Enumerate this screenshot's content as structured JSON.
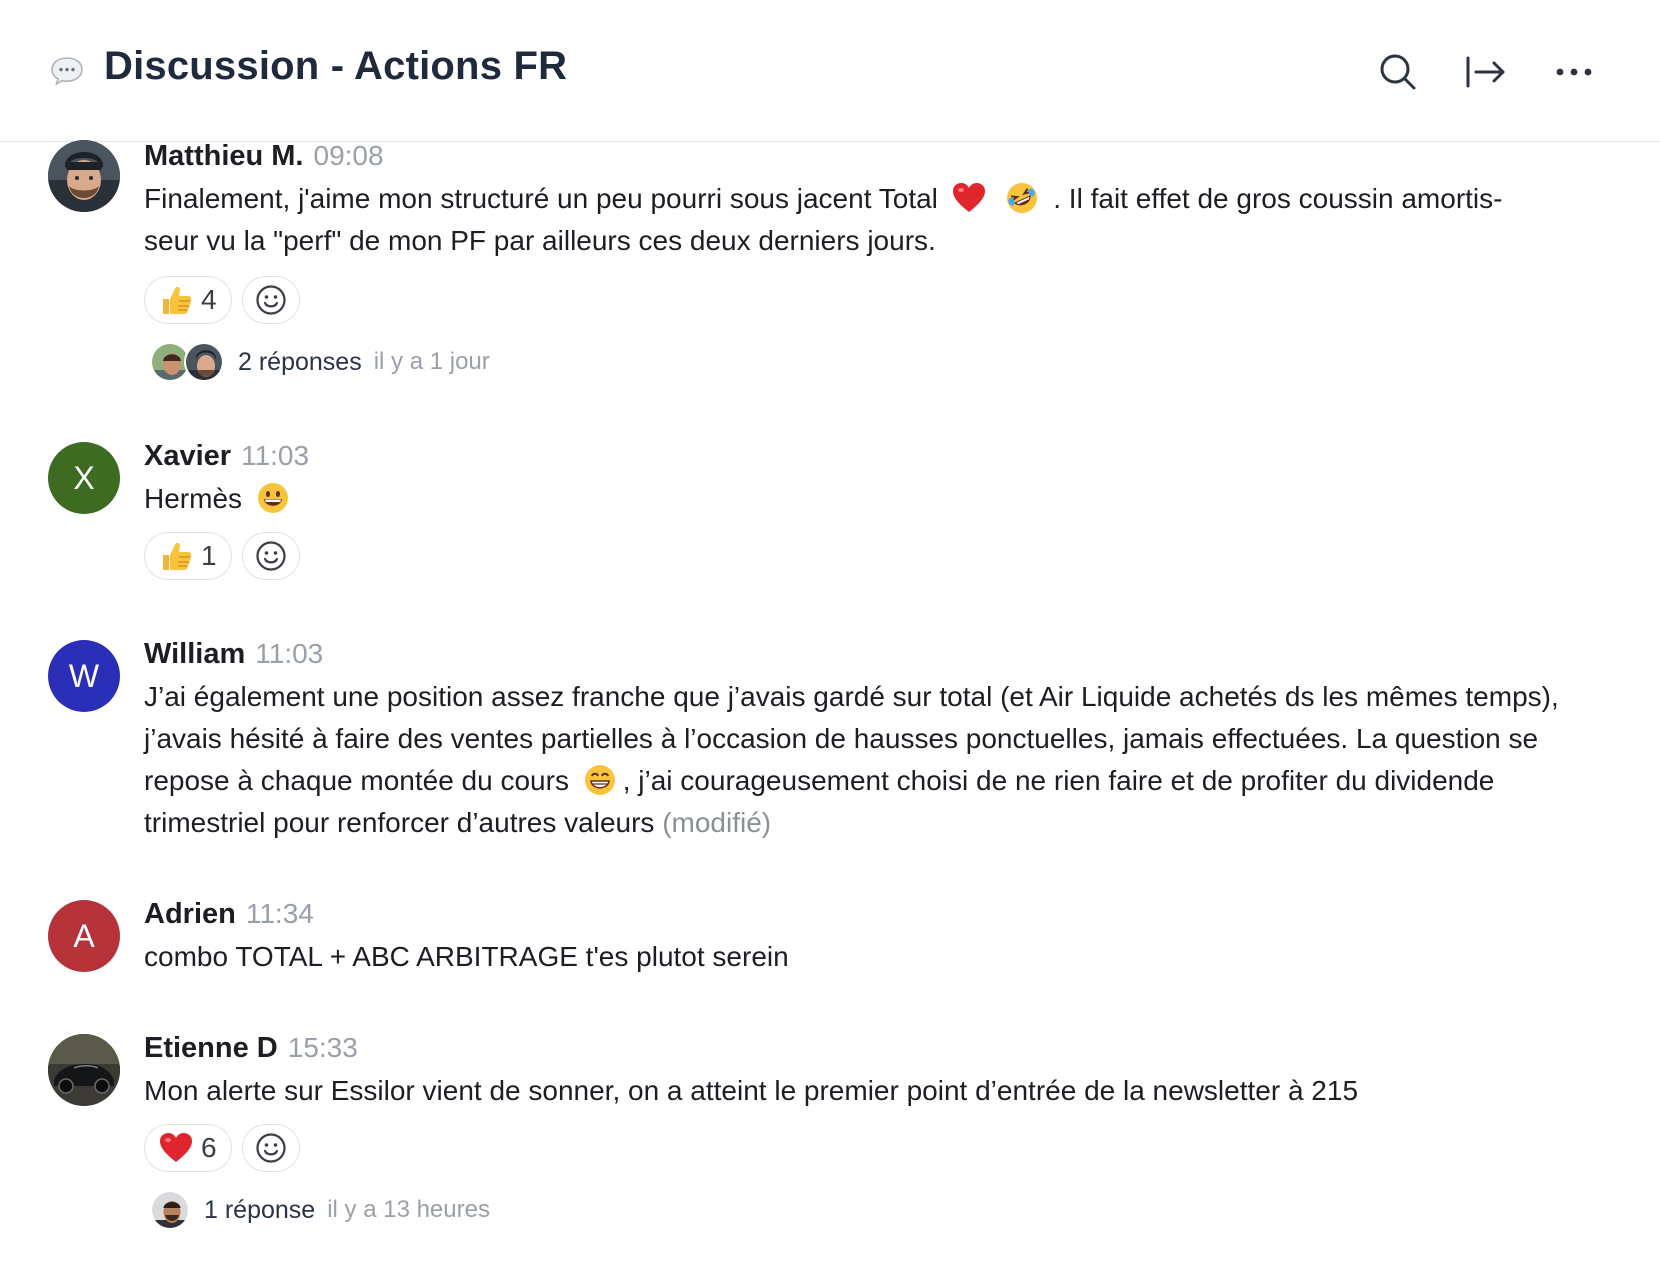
{
  "header": {
    "title": "Discussion - Actions FR",
    "icons": {
      "channel": "chat-bubble-icon",
      "search": "search-icon",
      "leave": "exit-arrow-icon",
      "more": "more-dots-icon"
    }
  },
  "colors": {
    "title": "#1f2a3c",
    "avatar_xavier": "#3d6b22",
    "avatar_william": "#2b2fb8",
    "avatar_adrien": "#b7333a",
    "muted": "#9aa0a8"
  },
  "messages": [
    {
      "author": "Matthieu M.",
      "time": "09:08",
      "text_a": "Finalement, j'aime mon structuré un peu pourri sous jacent Total",
      "text_b": ". Il fait effet de gros coussin amortis-",
      "text_c": "seur vu la \"perf\" de mon PF par ailleurs ces deux derniers jours.",
      "inline_emojis": [
        "heart-emoji",
        "rofl-emoji"
      ],
      "reactions": [
        {
          "emoji": "thumbs-up-emoji",
          "count": "4"
        }
      ],
      "thread": {
        "count": "2 réponses",
        "time": "il y a 1 jour"
      }
    },
    {
      "author": "Xavier",
      "initial": "X",
      "time": "11:03",
      "text": "Hermès",
      "inline_emojis": [
        "grinning-face-emoji"
      ],
      "reactions": [
        {
          "emoji": "thumbs-up-emoji",
          "count": "1"
        }
      ]
    },
    {
      "author": "William",
      "initial": "W",
      "time": "11:03",
      "text_a": "J’ai également une position assez franche que j’avais gardé sur total (et Air Liquide achetés ds les mêmes temps), j’avais hésité à faire des ventes partielles à l’occasion de hausses ponctuelles, jamais effectuées. La question se repose à chaque montée du cours",
      "text_b": ", j’ai courageusement choisi de ne rien faire et de profiter du dividende trimestriel pour renforcer d’autres valeurs",
      "edited": "(modifié)",
      "inline_emojis": [
        "beaming-face-emoji"
      ]
    },
    {
      "author": "Adrien",
      "initial": "A",
      "time": "11:34",
      "text": "combo TOTAL + ABC ARBITRAGE t'es plutot serein"
    },
    {
      "author": "Etienne D",
      "time": "15:33",
      "text": "Mon alerte sur Essilor vient de sonner, on a atteint le premier point d’entrée de la newsletter à 215",
      "reactions": [
        {
          "emoji": "heart-emoji",
          "count": "6"
        }
      ],
      "thread": {
        "count": "1 réponse",
        "time": "il y a 13 heures"
      }
    }
  ]
}
